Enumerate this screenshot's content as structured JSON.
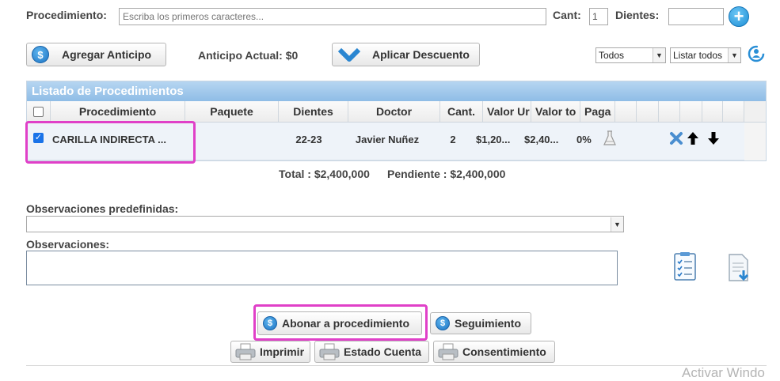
{
  "form": {
    "procedimiento_label": "Procedimiento:",
    "procedimiento_placeholder": "Escriba los primeros caracteres...",
    "cant_label": "Cant:",
    "cant_value": "1",
    "dientes_label": "Dientes:",
    "dientes_value": ""
  },
  "toolbar": {
    "agregar_anticipo": "Agregar Anticipo",
    "anticipo_actual": "Anticipo Actual: $0",
    "aplicar_descuento": "Aplicar Descuento",
    "filter_todos": "Todos",
    "filter_listar": "Listar todos"
  },
  "grid": {
    "title": "Listado de Procedimientos",
    "headers": [
      "Procedimiento",
      "Paquete",
      "Dientes",
      "Doctor",
      "Cant.",
      "Valor Ur",
      "Valor to",
      "Paga"
    ],
    "row": {
      "checked": true,
      "procedimiento": "CARILLA INDIRECTA ...",
      "paquete": "",
      "dientes": "22-23",
      "doctor": "Javier Nuñez",
      "cant": "2",
      "valor_unitario": "$1,20...",
      "valor_total": "$2,40...",
      "pagado": "0%"
    },
    "total": "Total : $2,400,000",
    "pendiente": "Pendiente : $2,400,000"
  },
  "observaciones": {
    "predefinidas_label": "Observaciones predefinidas:",
    "predefinidas_value": "",
    "label": "Observaciones:",
    "value": ""
  },
  "actions": {
    "abonar": "Abonar a procedimiento",
    "seguimiento": "Seguimiento",
    "imprimir": "Imprimir",
    "estado_cuenta": "Estado Cuenta",
    "consentimiento": "Consentimiento"
  },
  "watermark": "Activar Windo",
  "colors": {
    "grid_header": "#9fc8ec",
    "highlight": "#e040c8",
    "coin_blue": "#1d74c4"
  }
}
